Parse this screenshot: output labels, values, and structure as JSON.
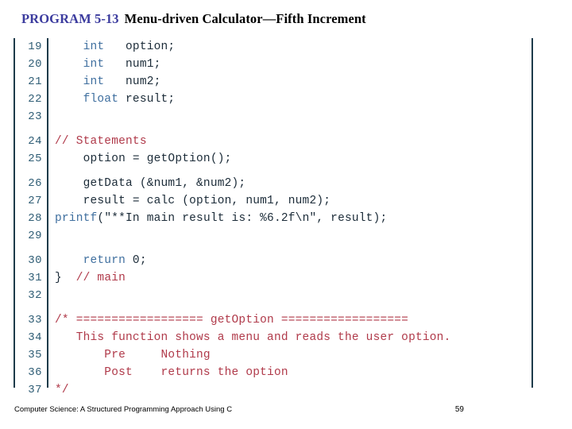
{
  "title": {
    "program_label": "PROGRAM 5-13",
    "heading": "Menu-driven Calculator—Fifth Increment",
    "program_color": "#3b3b9e",
    "heading_color": "#000000"
  },
  "code": {
    "border_color": "#1d3b4a",
    "line_number_color": "#2f5d75",
    "keyword_color": "#3f6f9f",
    "identifier_color": "#1b2b38",
    "comment_color": "#b03a4a",
    "groups": [
      {
        "lines": [
          {
            "n": "19",
            "indent": 4,
            "tokens": [
              {
                "t": "int",
                "c": "kw"
              },
              {
                "t": "   option;",
                "c": "idf"
              }
            ]
          },
          {
            "n": "20",
            "indent": 4,
            "tokens": [
              {
                "t": "int",
                "c": "kw"
              },
              {
                "t": "   num1;",
                "c": "idf"
              }
            ]
          },
          {
            "n": "21",
            "indent": 4,
            "tokens": [
              {
                "t": "int",
                "c": "kw"
              },
              {
                "t": "   num2;",
                "c": "idf"
              }
            ]
          },
          {
            "n": "22",
            "indent": 4,
            "tokens": [
              {
                "t": "float",
                "c": "kw"
              },
              {
                "t": " result;",
                "c": "idf"
              }
            ]
          },
          {
            "n": "23",
            "indent": 0,
            "tokens": []
          }
        ]
      },
      {
        "lines": [
          {
            "n": "24",
            "indent": 0,
            "tokens": [
              {
                "t": "// Statements",
                "c": "cmt"
              }
            ]
          },
          {
            "n": "25",
            "indent": 4,
            "tokens": [
              {
                "t": "option = getOption();",
                "c": "idf"
              }
            ]
          }
        ]
      },
      {
        "lines": [
          {
            "n": "26",
            "indent": 4,
            "tokens": [
              {
                "t": "getData (&num1, &num2);",
                "c": "idf"
              }
            ]
          },
          {
            "n": "27",
            "indent": 4,
            "tokens": [
              {
                "t": "result = calc (option, num1, num2);",
                "c": "idf"
              }
            ]
          },
          {
            "n": "28",
            "indent": 0,
            "tokens": [
              {
                "t": "printf",
                "c": "kw"
              },
              {
                "t": "(\"**In main result is: %6.2f\\n\", result);",
                "c": "idf"
              }
            ]
          },
          {
            "n": "29",
            "indent": 0,
            "tokens": []
          }
        ]
      },
      {
        "lines": [
          {
            "n": "30",
            "indent": 4,
            "tokens": [
              {
                "t": "return",
                "c": "kw"
              },
              {
                "t": " 0;",
                "c": "idf"
              }
            ]
          },
          {
            "n": "31",
            "indent": 0,
            "tokens": [
              {
                "t": "} ",
                "c": "idf"
              },
              {
                "t": " // main",
                "c": "cmt"
              }
            ]
          },
          {
            "n": "32",
            "indent": 0,
            "tokens": []
          }
        ]
      },
      {
        "lines": [
          {
            "n": "33",
            "indent": 0,
            "tokens": [
              {
                "t": "/* ================== getOption ==================",
                "c": "cmt"
              }
            ]
          },
          {
            "n": "34",
            "indent": 3,
            "tokens": [
              {
                "t": "This function shows a menu and reads the user option.",
                "c": "cmt"
              }
            ]
          },
          {
            "n": "35",
            "indent": 7,
            "tokens": [
              {
                "t": "Pre     Nothing",
                "c": "cmt"
              }
            ]
          },
          {
            "n": "36",
            "indent": 7,
            "tokens": [
              {
                "t": "Post    returns the option",
                "c": "cmt"
              }
            ]
          },
          {
            "n": "37",
            "indent": 0,
            "tokens": [
              {
                "t": "*/",
                "c": "cmt"
              }
            ]
          }
        ]
      }
    ]
  },
  "footer": {
    "book_title": "Computer Science: A Structured Programming Approach Using C",
    "page_number": "59"
  }
}
